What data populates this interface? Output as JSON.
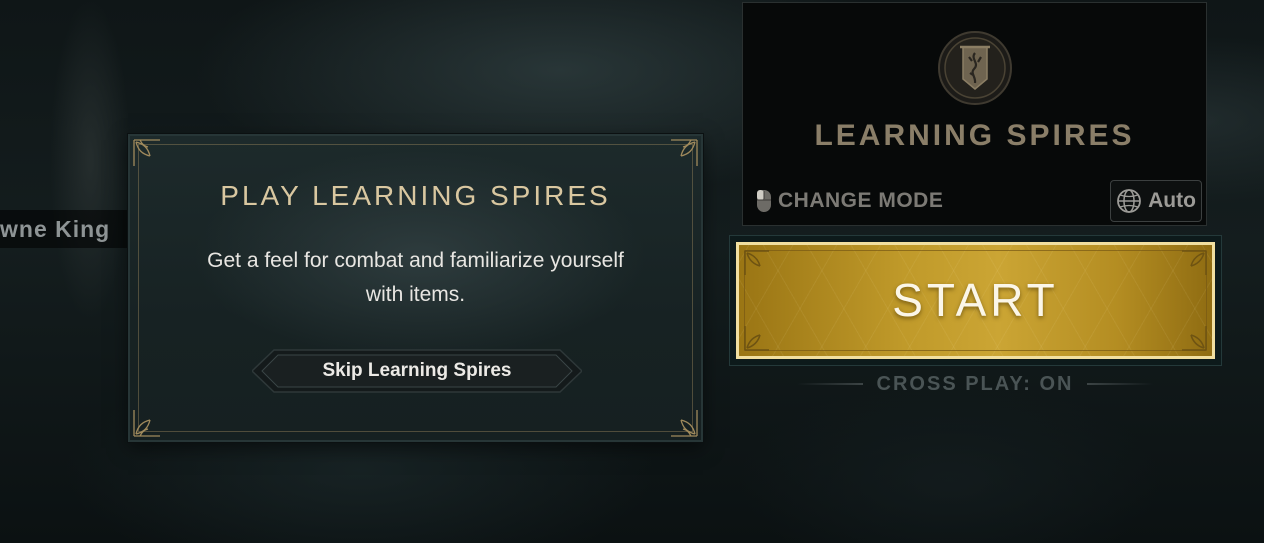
{
  "background": {
    "player_name_partial": "wne King"
  },
  "popup": {
    "title": "PLAY LEARNING SPIRES",
    "description": "Get a feel for combat and familiarize yourself with items.",
    "skip_button": "Skip Learning Spires"
  },
  "mode_card": {
    "emblem_icon": "spires-banner-emblem-icon",
    "title": "LEARNING SPIRES",
    "change_mode_icon": "mouse-icon",
    "change_mode_label": "CHANGE MODE",
    "region_icon": "globe-icon",
    "region_label": "Auto"
  },
  "start": {
    "label": "START"
  },
  "crossplay": {
    "label": "CROSS PLAY: ON"
  },
  "colors": {
    "gold_accent": "#c09a2a",
    "title_gold": "#d9c7a0",
    "start_border": "#f1dfa0"
  }
}
